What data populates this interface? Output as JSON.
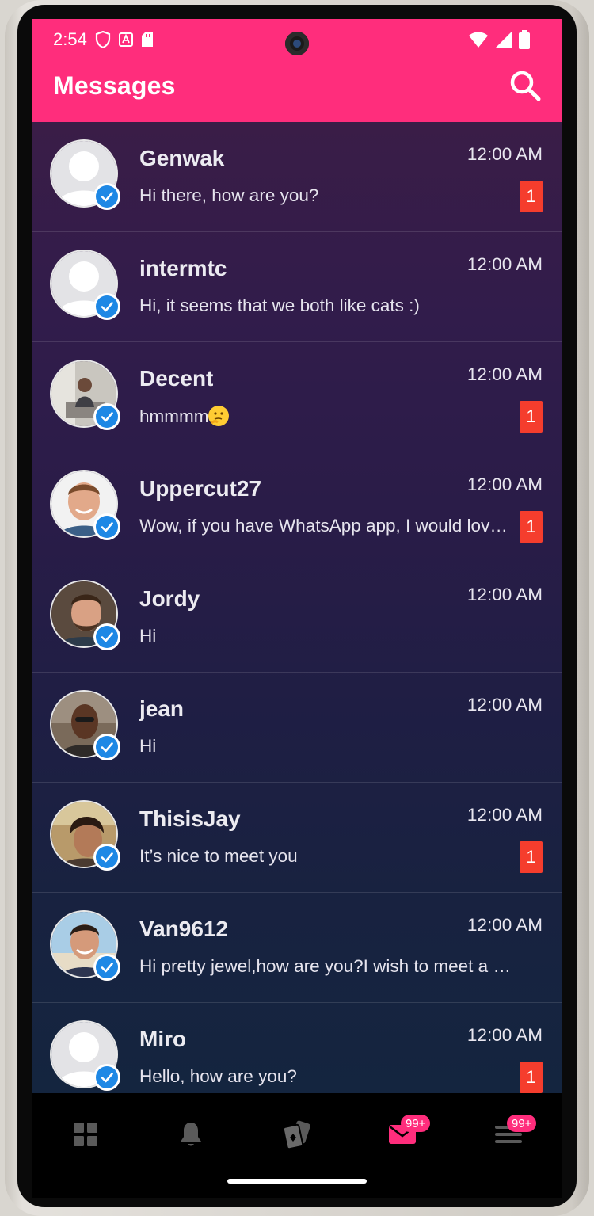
{
  "status_bar": {
    "time": "2:54"
  },
  "header": {
    "title": "Messages"
  },
  "conversations": [
    {
      "name": "Genwak",
      "preview": "Hi there, how are you?",
      "time": "12:00 AM",
      "unread": "1",
      "avatar": "default"
    },
    {
      "name": "intermtc",
      "preview": "Hi, it seems that we both like cats :)",
      "time": "12:00 AM",
      "unread": "",
      "avatar": "default"
    },
    {
      "name": "Decent",
      "preview": "hmmmm",
      "time": "12:00 AM",
      "unread": "1",
      "avatar": "photo"
    },
    {
      "name": "Uppercut27",
      "preview": "Wow, if you have WhatsApp app, I would love to chat with you there",
      "time": "12:00 AM",
      "unread": "1",
      "avatar": "photo"
    },
    {
      "name": "Jordy",
      "preview": "Hi",
      "time": "12:00 AM",
      "unread": "",
      "avatar": "photo"
    },
    {
      "name": "jean",
      "preview": "Hi",
      "time": "12:00 AM",
      "unread": "",
      "avatar": "photo"
    },
    {
      "name": "ThisisJay",
      "preview": "It’s nice to meet you",
      "time": "12:00 AM",
      "unread": "1",
      "avatar": "photo"
    },
    {
      "name": "Van9612",
      "preview": "Hi pretty jewel,how are you?I wish to meet a attractive person",
      "time": "12:00 AM",
      "unread": "",
      "avatar": "photo"
    },
    {
      "name": "Miro",
      "preview": "Hello, how are you?",
      "time": "12:00 AM",
      "unread": "1",
      "avatar": "default"
    }
  ],
  "bottom_nav": {
    "items": [
      {
        "icon": "grid-icon",
        "badge": ""
      },
      {
        "icon": "bell-icon",
        "badge": ""
      },
      {
        "icon": "cards-icon",
        "badge": ""
      },
      {
        "icon": "envelope-icon",
        "badge": "99+",
        "active": true
      },
      {
        "icon": "menu-icon",
        "badge": "99+"
      }
    ]
  },
  "colors": {
    "accent": "#ff2d7c",
    "badge_red": "#f53d2d",
    "verified_blue": "#1e88e5",
    "list_bg_top": "#3a1d47",
    "list_bg_bottom": "#14253f"
  }
}
